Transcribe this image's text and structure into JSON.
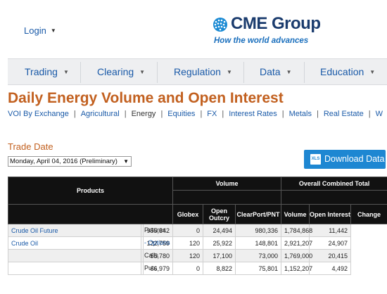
{
  "header": {
    "login_label": "Login",
    "brand_name": "CME Group",
    "tagline": "How the world advances"
  },
  "nav": {
    "items": [
      {
        "label": "Trading"
      },
      {
        "label": "Clearing"
      },
      {
        "label": "Regulation"
      },
      {
        "label": "Data"
      },
      {
        "label": "Education"
      }
    ]
  },
  "page": {
    "title": "Daily Energy Volume and Open Interest"
  },
  "subnav": {
    "items": [
      "VOI By Exchange",
      "Agricultural",
      "Energy",
      "Equities",
      "FX",
      "Interest Rates",
      "Metals",
      "Real Estate",
      "W"
    ],
    "active": "Energy"
  },
  "trade_date": {
    "label": "Trade Date",
    "selected": "Monday, April 04, 2016 (Preliminary)"
  },
  "download": {
    "icon_text": "XLS",
    "label": "Download Data"
  },
  "table": {
    "group_headers": {
      "products": "Products",
      "volume": "Volume",
      "overall": "Overall Combined Total"
    },
    "columns": {
      "globex": "Globex",
      "open_outcry": "Open Outcry",
      "clearport": "ClearPort/PNT",
      "volume": "Volume",
      "open_interest": "Open Interest",
      "change": "Change"
    },
    "rows": [
      {
        "product": "Crude Oil Future",
        "type": "Futures",
        "globex": "955,842",
        "open_outcry": "0",
        "clearport": "24,494",
        "volume": "980,336",
        "open_interest": "1,784,868",
        "change": "11,442"
      },
      {
        "product": "Crude Oil",
        "type": "- Options",
        "globex": "122,759",
        "open_outcry": "120",
        "clearport": "25,922",
        "volume": "148,801",
        "open_interest": "2,921,207",
        "change": "24,907"
      },
      {
        "product": "",
        "type": "Calls",
        "globex": "55,780",
        "open_outcry": "120",
        "clearport": "17,100",
        "volume": "73,000",
        "open_interest": "1,769,000",
        "change": "20,415"
      },
      {
        "product": "",
        "type": "Puts",
        "globex": "66,979",
        "open_outcry": "0",
        "clearport": "8,822",
        "volume": "75,801",
        "open_interest": "1,152,207",
        "change": "4,492"
      }
    ]
  },
  "colors": {
    "accent_orange": "#c2601f",
    "link_blue": "#1a5aa8",
    "button_blue": "#1e87d2",
    "header_black": "#111111",
    "brand_navy": "#1b3c6e"
  },
  "icons": [
    "chevron-down-icon",
    "globe-icon",
    "xls-file-icon"
  ]
}
